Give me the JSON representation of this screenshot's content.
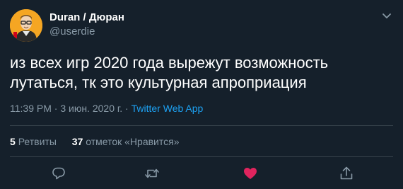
{
  "user": {
    "name": "Duran / Дюран",
    "handle": "@userdie"
  },
  "tweet": {
    "text": "из всех игр 2020 года вырежут возможность лутаться, тк это культурная апроприация",
    "time": "11:39 PM",
    "separator1": " · ",
    "date": "3 июн. 2020 г.",
    "separator2": " · ",
    "source": "Twitter Web App"
  },
  "stats": {
    "retweets_count": "5",
    "retweets_label": "Ретвиты",
    "likes_count": "37",
    "likes_label": "отметок «Нравится»"
  },
  "icons": {
    "reply": "reply-icon",
    "retweet": "retweet-icon",
    "like": "heart-icon",
    "share": "share-icon",
    "menu": "chevron-down-icon"
  },
  "colors": {
    "background": "#15202b",
    "accent": "#1da1f2",
    "like": "#e0245e",
    "muted": "#8899a6",
    "avatar_bg": "#f5a623"
  }
}
